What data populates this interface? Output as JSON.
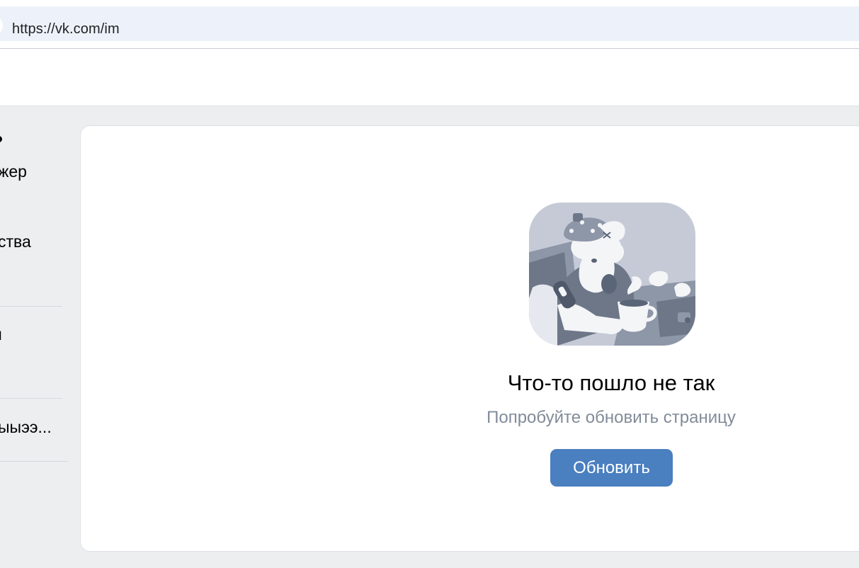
{
  "browser": {
    "url": "https://vk.com/im"
  },
  "sidebar": {
    "items": [
      {
        "label": "жер"
      },
      {
        "label": "ства"
      },
      {
        "label": "ı"
      },
      {
        "label": "ыыээ..."
      }
    ]
  },
  "error": {
    "title": "Что-то пошло не так",
    "subtitle": "Попробуйте обновить страницу",
    "button_label": "Обновить",
    "illustration_icon": "sick-dog-illustration"
  },
  "colors": {
    "page_background": "#edeef0",
    "button": "#4a7fc0",
    "subtitle": "#818c99",
    "address_bar": "#edf2fa"
  }
}
